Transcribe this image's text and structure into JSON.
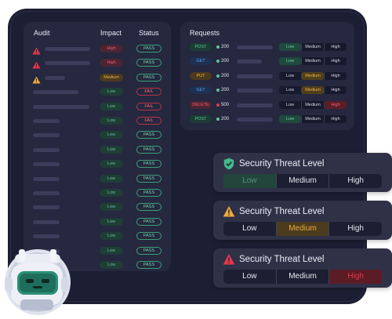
{
  "audit": {
    "headers": {
      "audit": "Audit",
      "impact": "Impact",
      "status": "Status"
    },
    "rows": [
      {
        "warn": "high",
        "impact": "High",
        "status": "PASS"
      },
      {
        "warn": "high",
        "impact": "High",
        "status": "PASS"
      },
      {
        "warn": "medium",
        "impact": "Medium",
        "status": "PASS"
      },
      {
        "warn": "",
        "impact": "Low",
        "status": "FAIL"
      },
      {
        "warn": "",
        "impact": "Low",
        "status": "FAIL"
      },
      {
        "warn": "",
        "impact": "Low",
        "status": "FAIL"
      },
      {
        "warn": "",
        "impact": "Low",
        "status": "PASS"
      },
      {
        "warn": "",
        "impact": "Low",
        "status": "PASS"
      },
      {
        "warn": "",
        "impact": "Low",
        "status": "PASS"
      },
      {
        "warn": "",
        "impact": "Low",
        "status": "PASS"
      },
      {
        "warn": "",
        "impact": "Low",
        "status": "PASS"
      },
      {
        "warn": "",
        "impact": "Low",
        "status": "PASS"
      },
      {
        "warn": "",
        "impact": "Low",
        "status": "PASS"
      },
      {
        "warn": "",
        "impact": "Low",
        "status": "PASS"
      },
      {
        "warn": "",
        "impact": "Low",
        "status": "PASS"
      },
      {
        "warn": "",
        "impact": "Low",
        "status": "PASS"
      }
    ]
  },
  "requests": {
    "title": "Requests",
    "levels": [
      "Low",
      "Medium",
      "High"
    ],
    "rows": [
      {
        "method": "POST",
        "code": "200",
        "active": "Low"
      },
      {
        "method": "GET",
        "code": "200",
        "active": "Low"
      },
      {
        "method": "PUT",
        "code": "200",
        "active": "Medium"
      },
      {
        "method": "GET",
        "code": "200",
        "active": "Medium"
      },
      {
        "method": "DELETE",
        "code": "500",
        "active": "High"
      },
      {
        "method": "POST",
        "code": "200",
        "active": "Low"
      }
    ]
  },
  "threat_cards": [
    {
      "title": "Security Threat Level",
      "icon": "shield-check-icon",
      "active": "Low",
      "levels": [
        "Low",
        "Medium",
        "High"
      ]
    },
    {
      "title": "Security Threat Level",
      "icon": "warning-icon",
      "active": "Medium",
      "levels": [
        "Low",
        "Medium",
        "High"
      ]
    },
    {
      "title": "Security Threat Level",
      "icon": "alert-icon",
      "active": "High",
      "levels": [
        "Low",
        "Medium",
        "High"
      ]
    }
  ],
  "colors": {
    "low": "#5bc79a",
    "medium": "#f2a93b",
    "high": "#e8354a",
    "panel": "#25283f",
    "frame": "#1c1e33"
  }
}
